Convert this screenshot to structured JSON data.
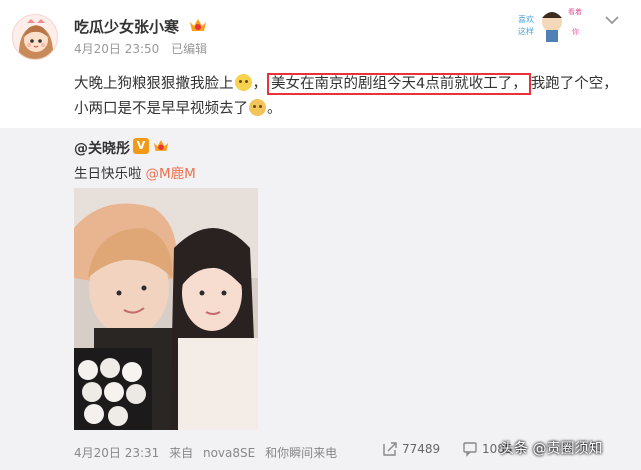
{
  "post": {
    "username": "吃瓜少女张小寒",
    "time": "4月20日 23:50",
    "edited": "已编辑",
    "sticker_text": [
      "喜欢",
      "这样",
      "看着",
      "你"
    ],
    "text_before": "大晚上狗粮狠狠撒我脸上",
    "comma": "，",
    "text_highlight": "美女在南京的剧组今天4点前就收工了，",
    "text_after": "我跑了个空，小两口是不是早早视频去了",
    "text_end": "。"
  },
  "repost": {
    "username": "@关晓彤",
    "verified_badge": "V",
    "text": "生日快乐啦",
    "mention": "@M鹿M",
    "time": "4月20日 23:31",
    "source_prefix": "来自",
    "source_device": "nova8SE",
    "source_suffix": "和你瞬间来电",
    "share_count": "77489",
    "comment_count": "1085",
    "watermark": "头条 @责圈须知"
  },
  "colors": {
    "highlight_border": "#e8333a",
    "mention": "#eb7350",
    "repost_bg": "#f2f2f5"
  },
  "icons": {
    "avatar": "girl-avatar-icon",
    "vip": "vip-crown-icon",
    "more": "chevron-down-icon",
    "share": "share-icon",
    "comment": "comment-icon"
  }
}
